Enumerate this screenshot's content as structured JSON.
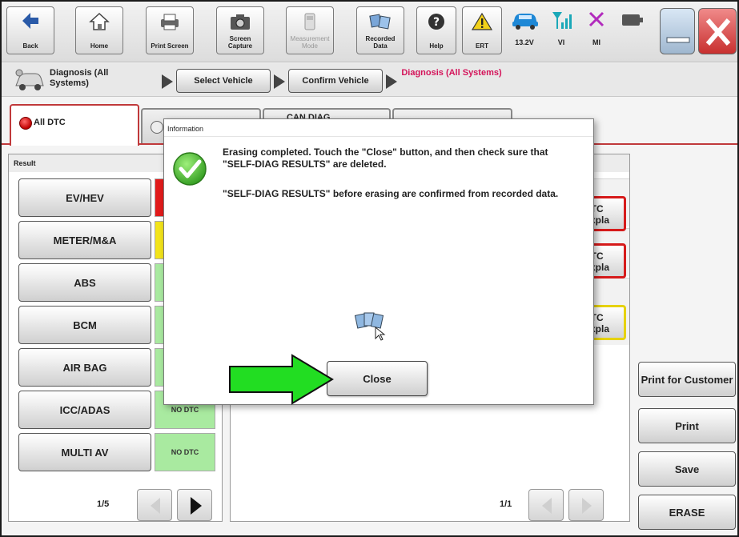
{
  "toolbar": {
    "back": "Back",
    "home": "Home",
    "print_screen": "Print Screen",
    "screen_capture": "Screen Capture",
    "measurement_mode": "Measurement Mode",
    "recorded_data": "Recorded Data",
    "help": "Help",
    "ert": "ERT",
    "battery_voltage": "13.2V",
    "vi": "VI",
    "mi": "MI"
  },
  "breadcrumb": {
    "title": "Diagnosis (All Systems)",
    "step1": "Select Vehicle",
    "step2": "Confirm Vehicle",
    "current": "Diagnosis (All Systems)"
  },
  "tabs": {
    "all_dtc": "All DTC",
    "can_diag": "CAN DIAG"
  },
  "result_panel": {
    "header": "Result",
    "systems": [
      {
        "name": "EV/HEV",
        "status": "",
        "color": "#e21b1b"
      },
      {
        "name": "METER/M&A",
        "status": "",
        "color": "#f3e41a"
      },
      {
        "name": "ABS",
        "status": "",
        "color": "#a9eaa0"
      },
      {
        "name": "BCM",
        "status": "",
        "color": "#a9eaa0"
      },
      {
        "name": "AIR BAG",
        "status": "",
        "color": "#a9eaa0"
      },
      {
        "name": "ICC/ADAS",
        "status": "NO DTC",
        "color": "#a9eaa0"
      },
      {
        "name": "MULTI AV",
        "status": "NO DTC",
        "color": "#a9eaa0"
      }
    ],
    "page": "1/5"
  },
  "detail_panel": {
    "dtc_buttons": [
      {
        "line1": "DTC",
        "line2": "Expla",
        "border": "#d61a1a"
      },
      {
        "line1": "DTC",
        "line2": "Expla",
        "border": "#d61a1a"
      },
      {
        "line1": "DTC",
        "line2": "Expla",
        "border": "#e6d20f"
      }
    ],
    "page": "1/1"
  },
  "right_buttons": {
    "print_for_customer": "Print for Customer",
    "print": "Print",
    "save": "Save",
    "erase": "ERASE"
  },
  "dialog": {
    "title": "Information",
    "message1": "Erasing completed. Touch the \"Close\" button, and then check sure that \"SELF-DIAG RESULTS\" are deleted.",
    "message2": "\"SELF-DIAG RESULTS\" before erasing are confirmed from recorded data.",
    "close": "Close"
  },
  "colors": {
    "accent_red": "#c0393b",
    "highlight_arrow": "#22dd22",
    "current_step": "#d4145a"
  }
}
